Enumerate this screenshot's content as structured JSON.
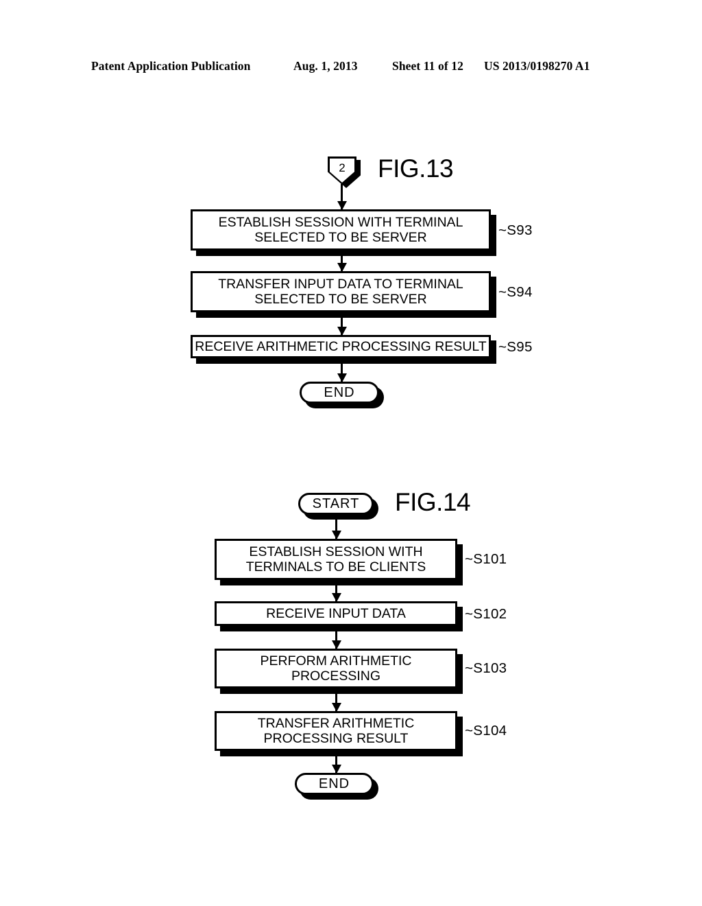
{
  "header": {
    "publication": "Patent Application Publication",
    "date": "Aug. 1, 2013",
    "sheet": "Sheet 11 of 12",
    "patent_number": "US 2013/0198270 A1"
  },
  "figures": [
    {
      "id": "fig13",
      "title": "FIG.13",
      "connector": {
        "label": "2",
        "name": "off-page-connector-2"
      },
      "steps": [
        {
          "ref": "~S93",
          "lines": [
            "ESTABLISH SESSION WITH TERMINAL",
            "SELECTED TO BE SERVER"
          ]
        },
        {
          "ref": "~S94",
          "lines": [
            "TRANSFER INPUT DATA TO TERMINAL",
            "SELECTED TO BE SERVER"
          ]
        },
        {
          "ref": "~S95",
          "lines": [
            "RECEIVE ARITHMETIC PROCESSING RESULT"
          ]
        }
      ],
      "terminator_end": "END"
    },
    {
      "id": "fig14",
      "title": "FIG.14",
      "terminator_start": "START",
      "steps": [
        {
          "ref": "~S101",
          "lines": [
            "ESTABLISH SESSION WITH",
            "TERMINALS TO BE CLIENTS"
          ]
        },
        {
          "ref": "~S102",
          "lines": [
            "RECEIVE INPUT DATA"
          ]
        },
        {
          "ref": "~S103",
          "lines": [
            "PERFORM ARITHMETIC",
            "PROCESSING"
          ]
        },
        {
          "ref": "~S104",
          "lines": [
            "TRANSFER ARITHMETIC",
            "PROCESSING RESULT"
          ]
        }
      ],
      "terminator_end": "END"
    }
  ],
  "colors": {
    "ink": "#000000",
    "paper": "#ffffff"
  }
}
